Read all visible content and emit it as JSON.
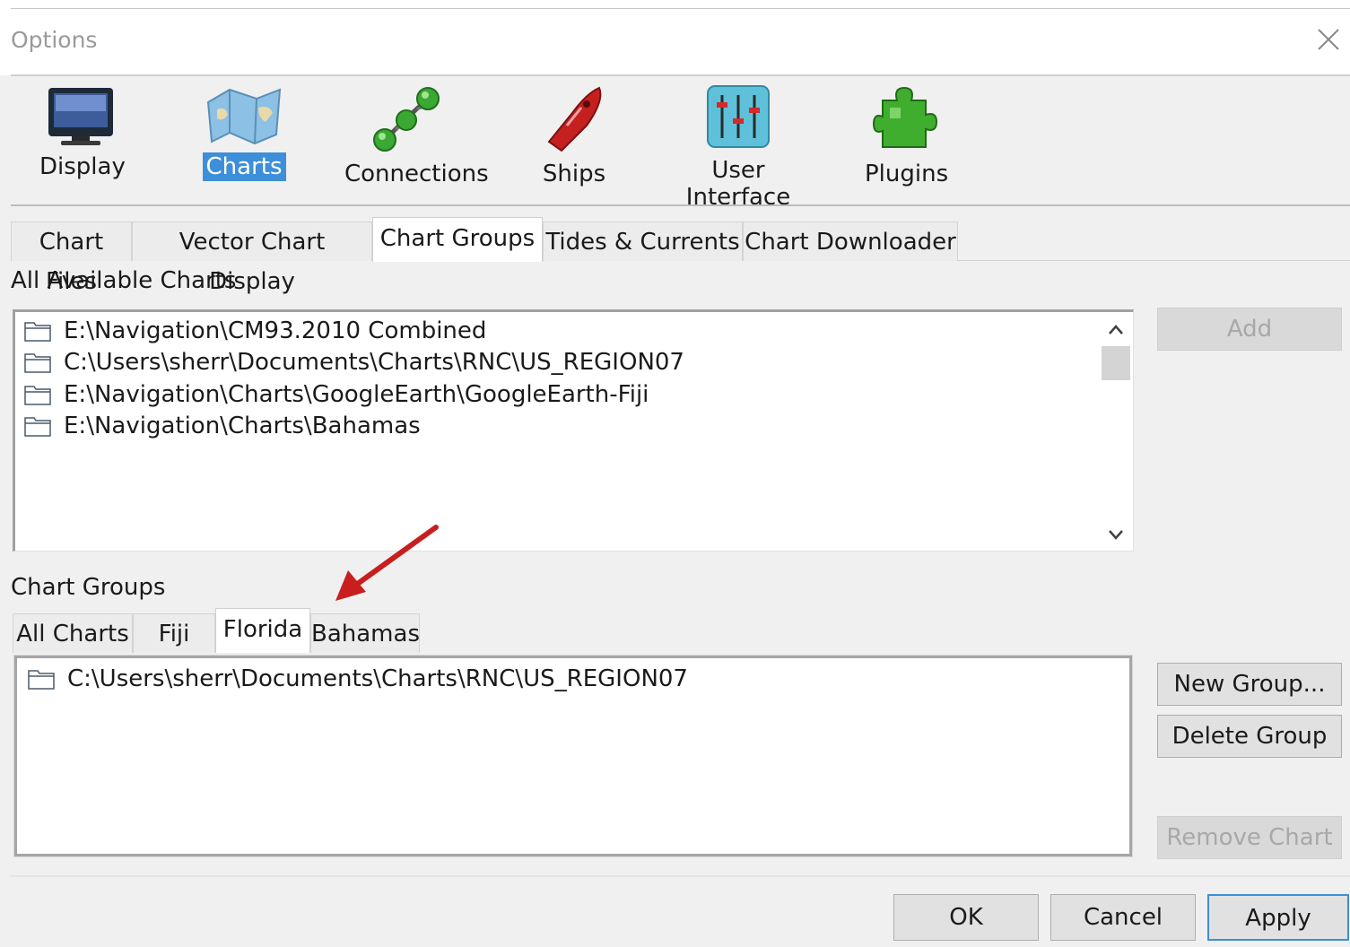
{
  "window": {
    "title": "Options"
  },
  "toolbar": {
    "categories": [
      {
        "label": "Display",
        "icon": "monitor-icon"
      },
      {
        "label": "Charts",
        "icon": "charts-map-icon",
        "selected": true
      },
      {
        "label": "Connections",
        "icon": "connections-icon"
      },
      {
        "label": "Ships",
        "icon": "ship-icon"
      },
      {
        "label": "User Interface",
        "icon": "sliders-icon"
      },
      {
        "label": "Plugins",
        "icon": "puzzle-icon"
      }
    ],
    "selected_color": "#3d8fd9"
  },
  "tabs": [
    {
      "label": "Chart Files"
    },
    {
      "label": "Vector Chart Display"
    },
    {
      "label": "Chart Groups",
      "active": true
    },
    {
      "label": "Tides & Currents"
    },
    {
      "label": "Chart Downloader"
    }
  ],
  "available": {
    "label": "All Available Charts",
    "items": [
      "E:\\Navigation\\CM93.2010 Combined",
      "C:\\Users\\sherr\\Documents\\Charts\\RNC\\US_REGION07",
      "E:\\Navigation\\Charts\\GoogleEarth\\GoogleEarth-Fiji",
      "E:\\Navigation\\Charts\\Bahamas"
    ],
    "add_label": "Add"
  },
  "groups": {
    "label": "Chart Groups",
    "tabs": [
      {
        "label": "All Charts"
      },
      {
        "label": "Fiji"
      },
      {
        "label": "Florida",
        "active": true
      },
      {
        "label": "Bahamas"
      }
    ],
    "items": [
      "C:\\Users\\sherr\\Documents\\Charts\\RNC\\US_REGION07"
    ],
    "new_group_label": "New Group...",
    "delete_group_label": "Delete Group",
    "remove_chart_label": "Remove Chart"
  },
  "footer": {
    "ok_label": "OK",
    "cancel_label": "Cancel",
    "apply_label": "Apply"
  },
  "annotation": {
    "icon": "red-arrow-icon",
    "color": "#c81e1e"
  }
}
